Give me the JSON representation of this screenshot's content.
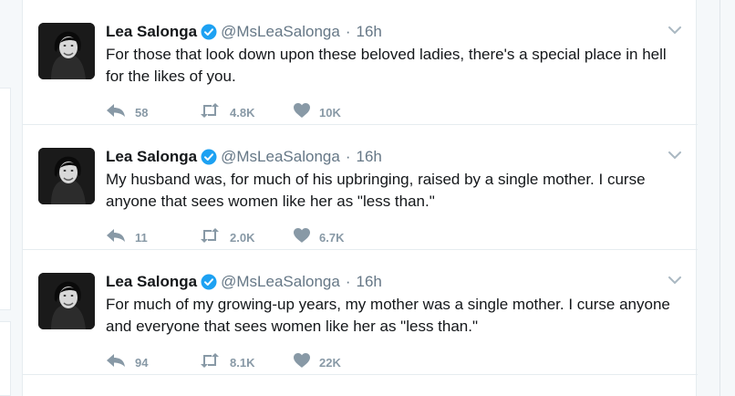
{
  "tweets": [
    {
      "name": "Lea Salonga",
      "handle": "@MsLeaSalonga",
      "separator": "·",
      "time": "16h",
      "text": "For those that look down upon these beloved ladies, there's a special place in hell for the likes of you.",
      "replies": "58",
      "retweets": "4.8K",
      "likes": "10K"
    },
    {
      "name": "Lea Salonga",
      "handle": "@MsLeaSalonga",
      "separator": "·",
      "time": "16h",
      "text": "My husband was, for much of his upbringing, raised by a single mother. I curse anyone that sees women like her as \"less than.\"",
      "replies": "11",
      "retweets": "2.0K",
      "likes": "6.7K"
    },
    {
      "name": "Lea Salonga",
      "handle": "@MsLeaSalonga",
      "separator": "·",
      "time": "16h",
      "text": "For much of my growing-up years, my mother was a single mother. I curse anyone and everyone that sees women like her as \"less than.\"",
      "replies": "94",
      "retweets": "8.1K",
      "likes": "22K"
    }
  ],
  "icons": {
    "verified": "verified-badge-icon",
    "caret": "chevron-down-icon",
    "reply": "reply-icon",
    "retweet": "retweet-icon",
    "like": "heart-icon"
  },
  "colors": {
    "verified": "#1da1f2",
    "action_gray": "#8899a6",
    "secondary_text": "#657786"
  }
}
